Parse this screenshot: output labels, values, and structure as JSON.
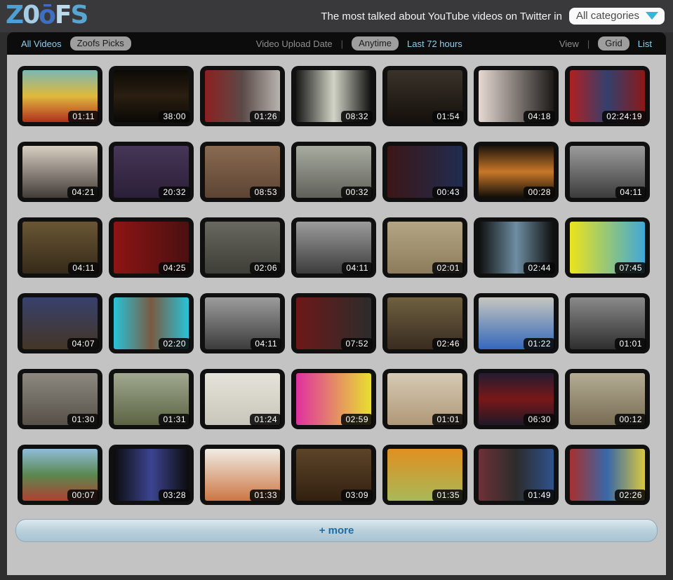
{
  "colors": {
    "outer-bg": "#2e2e2e",
    "header-bg": "#39393b",
    "navbar-bg": "#0c0c0c",
    "content-bg": "#c3c3c3",
    "link-blue": "#8ccfee",
    "muted-gray": "#8f8f8f",
    "pill-bg": "#9e9e9e",
    "pill-text": "#1c1c1c",
    "dropdown-arrow": "#35b5d8",
    "more-text": "#1b6ea5",
    "badge-text": "#ffffff"
  },
  "header": {
    "logo_letters": [
      {
        "char": "Z",
        "color": "#4e9fd4"
      },
      {
        "char": "0",
        "color": "#a6cde6"
      },
      {
        "char": "ō",
        "color": "#3f6fc2"
      },
      {
        "char": "F",
        "color": "#bcdaed"
      },
      {
        "char": "S",
        "color": "#57a6d2"
      }
    ],
    "tagline": "The most talked about YouTube videos on Twitter in",
    "category_dropdown": "All categories"
  },
  "navbar": {
    "all_videos": "All Videos",
    "zoofs_picks": "Zoofs Picks",
    "upload_date_label": "Video Upload Date",
    "divider": "|",
    "anytime": "Anytime",
    "last_72_hours": "Last 72 hours",
    "view_label": "View",
    "grid": "Grid",
    "list": "List"
  },
  "more_button_label": "+ more",
  "thumbnails": [
    {
      "duration": "01:11",
      "name": "simpsons-cartoon",
      "dir": "v",
      "colors": [
        "#7ab8b4",
        "#e0b93c",
        "#b03020"
      ]
    },
    {
      "duration": "38:00",
      "name": "press-speech-stage",
      "dir": "v",
      "colors": [
        "#0d0a06",
        "#2a1f10",
        "#0a0806"
      ]
    },
    {
      "duration": "01:26",
      "name": "pop-stars-split",
      "dir": "h",
      "colors": [
        "#8c2020",
        "#5a4a48",
        "#b8b4b0"
      ]
    },
    {
      "duration": "08:32",
      "name": "tablet-in-hand",
      "dir": "h",
      "colors": [
        "#181818",
        "#d2d4c6",
        "#101010"
      ]
    },
    {
      "duration": "01:54",
      "name": "record-store",
      "dir": "v",
      "colors": [
        "#3a332a",
        "#15100c"
      ]
    },
    {
      "duration": "04:18",
      "name": "girl-at-piano",
      "dir": "h",
      "colors": [
        "#e6d9d2",
        "#1c1a18"
      ]
    },
    {
      "duration": "02:24:19",
      "name": "red-blue-poster",
      "dir": "h",
      "colors": [
        "#b02020",
        "#33406e",
        "#8c1818"
      ]
    },
    {
      "duration": "04:21",
      "name": "teen-duet",
      "dir": "v",
      "colors": [
        "#d8cfc2",
        "#423c38"
      ]
    },
    {
      "duration": "20:32",
      "name": "purple-stage-talk",
      "dir": "v",
      "colors": [
        "#473657",
        "#2a1f38"
      ]
    },
    {
      "duration": "08:53",
      "name": "boxer-closeup",
      "dir": "v",
      "colors": [
        "#8a6a50",
        "#5c4434"
      ]
    },
    {
      "duration": "00:32",
      "name": "street-crowd",
      "dir": "v",
      "colors": [
        "#a8aca0",
        "#60605a"
      ]
    },
    {
      "duration": "00:43",
      "name": "night-crash-scene",
      "dir": "h",
      "colors": [
        "#3c1616",
        "#202c50"
      ]
    },
    {
      "duration": "00:28",
      "name": "night-street-lights",
      "dir": "v",
      "colors": [
        "#1c140c",
        "#c87828",
        "#100c08"
      ]
    },
    {
      "duration": "04:11",
      "name": "cat-mourning",
      "dir": "v",
      "colors": [
        "#9c9c9c",
        "#3c3c3c"
      ]
    },
    {
      "duration": "04:11",
      "name": "market-scene",
      "dir": "v",
      "colors": [
        "#6a5636",
        "#352a18"
      ]
    },
    {
      "duration": "04:25",
      "name": "red-news-studio",
      "dir": "h",
      "colors": [
        "#8e1414",
        "#4a1010"
      ]
    },
    {
      "duration": "02:06",
      "name": "truck-overhead",
      "dir": "v",
      "colors": [
        "#686860",
        "#3e3e38"
      ]
    },
    {
      "duration": "04:11",
      "name": "cat-mourning",
      "dir": "v",
      "colors": [
        "#9c9c9c",
        "#3c3c3c"
      ]
    },
    {
      "duration": "02:01",
      "name": "soldiers-wall",
      "dir": "v",
      "colors": [
        "#b4a684",
        "#8c7c5c"
      ]
    },
    {
      "duration": "02:44",
      "name": "truck-interior-doorway",
      "dir": "h",
      "colors": [
        "#0e0e0e",
        "#6e8ea2",
        "#0e0e0e"
      ]
    },
    {
      "duration": "07:45",
      "name": "yellow-vlog-duo",
      "dir": "h",
      "colors": [
        "#ece41c",
        "#3fa8d8"
      ]
    },
    {
      "duration": "04:07",
      "name": "band-in-studio",
      "dir": "v",
      "colors": [
        "#38406c",
        "#443626"
      ]
    },
    {
      "duration": "02:20",
      "name": "teen-star-rays",
      "dir": "h",
      "colors": [
        "#28c4d8",
        "#7a5a42",
        "#28c4d8"
      ]
    },
    {
      "duration": "04:11",
      "name": "cat-mourning",
      "dir": "v",
      "colors": [
        "#9c9c9c",
        "#3c3c3c"
      ]
    },
    {
      "duration": "07:52",
      "name": "tv-interview",
      "dir": "h",
      "colors": [
        "#6e1818",
        "#2c2c2c"
      ]
    },
    {
      "duration": "02:46",
      "name": "screaming-webcam-duo",
      "dir": "v",
      "colors": [
        "#6e6040",
        "#3a2c20"
      ]
    },
    {
      "duration": "01:22",
      "name": "robot-with-ball",
      "dir": "v",
      "colors": [
        "#c6c6be",
        "#3468bc"
      ]
    },
    {
      "duration": "01:01",
      "name": "gray-portrait",
      "dir": "v",
      "colors": [
        "#8a8a8a",
        "#2e2e2e"
      ]
    },
    {
      "duration": "01:30",
      "name": "expo-booth",
      "dir": "v",
      "colors": [
        "#8c8880",
        "#565048"
      ]
    },
    {
      "duration": "01:31",
      "name": "car-in-field",
      "dir": "v",
      "colors": [
        "#a0a890",
        "#5c6444"
      ]
    },
    {
      "duration": "01:24",
      "name": "text-card-ad",
      "dir": "v",
      "colors": [
        "#e6e4da",
        "#c8c6ba"
      ]
    },
    {
      "duration": "02:59",
      "name": "pink-pop-video",
      "dir": "h",
      "colors": [
        "#e030a0",
        "#e8e030"
      ]
    },
    {
      "duration": "01:01",
      "name": "mattress-commercial",
      "dir": "v",
      "colors": [
        "#d6cab4",
        "#b09878"
      ]
    },
    {
      "duration": "06:30",
      "name": "conference-stage",
      "dir": "v",
      "colors": [
        "#241c30",
        "#781818",
        "#201828"
      ]
    },
    {
      "duration": "00:12",
      "name": "enquiries-sign-dancers",
      "dir": "v",
      "colors": [
        "#b4ac94",
        "#786c54"
      ]
    },
    {
      "duration": "00:07",
      "name": "pole-vault",
      "dir": "v",
      "colors": [
        "#90bcd8",
        "#5a8850",
        "#b04030"
      ]
    },
    {
      "duration": "03:28",
      "name": "guitar-webcam",
      "dir": "h",
      "colors": [
        "#0c0c0c",
        "#3c4490",
        "#0c0c0c"
      ]
    },
    {
      "duration": "01:33",
      "name": "paint-splatter",
      "dir": "v",
      "colors": [
        "#f0ece4",
        "#cc7744"
      ]
    },
    {
      "duration": "03:09",
      "name": "flashmob-overhead",
      "dir": "v",
      "colors": [
        "#5c4428",
        "#32200f"
      ]
    },
    {
      "duration": "01:35",
      "name": "cartoon-fruit-faces",
      "dir": "v",
      "colors": [
        "#e09020",
        "#a8b858"
      ]
    },
    {
      "duration": "01:49",
      "name": "official-interview-flag",
      "dir": "h",
      "colors": [
        "#6e3038",
        "#2c2c2c",
        "#30528c"
      ]
    },
    {
      "duration": "02:26",
      "name": "baby-crawl-race",
      "dir": "h",
      "colors": [
        "#a83030",
        "#3868a8",
        "#d8c840"
      ]
    }
  ]
}
